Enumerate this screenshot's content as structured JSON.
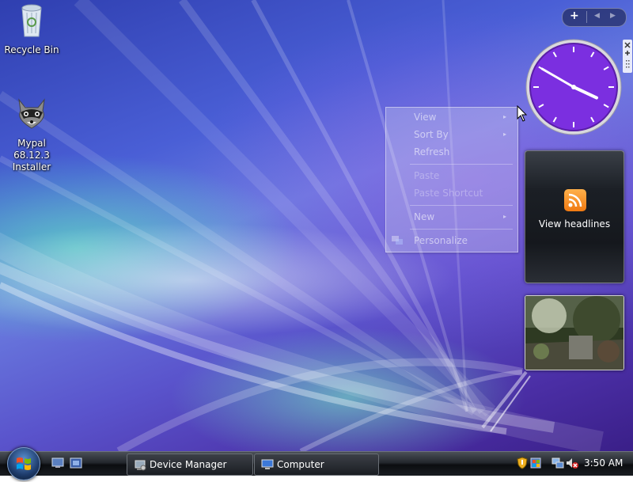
{
  "desktop": {
    "icons": [
      {
        "label": "Recycle Bin",
        "icon": "recycle-bin-icon"
      },
      {
        "label": "Mypal 68.12.3 Installer",
        "icon": "raccoon-installer-icon"
      }
    ]
  },
  "sidebar": {
    "add_button": "+",
    "prev_button": "◀",
    "next_button": "▶",
    "clock": {
      "hour": 3,
      "minute": 50
    },
    "feed_gadget": {
      "label": "View headlines",
      "icon": "rss-icon"
    },
    "slideshow": {
      "icon": "photo-slideshow"
    }
  },
  "context_menu": {
    "items": [
      {
        "label": "View",
        "submenu": true,
        "disabled": false
      },
      {
        "label": "Sort By",
        "submenu": true,
        "disabled": false
      },
      {
        "label": "Refresh",
        "submenu": false,
        "disabled": false
      },
      {
        "label": "Paste",
        "submenu": false,
        "disabled": true
      },
      {
        "label": "Paste Shortcut",
        "submenu": false,
        "disabled": true
      },
      {
        "label": "New",
        "submenu": true,
        "disabled": false
      },
      {
        "label": "Personalize",
        "submenu": false,
        "disabled": false
      }
    ],
    "submenu_arrow": "▸"
  },
  "taskbar": {
    "start_icon": "windows-logo-icon",
    "quick_launch": [
      "show-desktop-icon",
      "switch-windows-icon"
    ],
    "buttons": [
      {
        "label": "Device Manager",
        "icon": "device-manager-icon"
      },
      {
        "label": "Computer",
        "icon": "computer-icon"
      }
    ],
    "tray_icons": [
      "security-shield-icon",
      "windows-update-icon",
      "network-icon",
      "volume-muted-icon"
    ],
    "time": "3:50 AM"
  },
  "colors": {
    "clock_face": "#7b2fe0",
    "rss_orange": "#f58a1f",
    "taskbar": "#1a1d22"
  }
}
